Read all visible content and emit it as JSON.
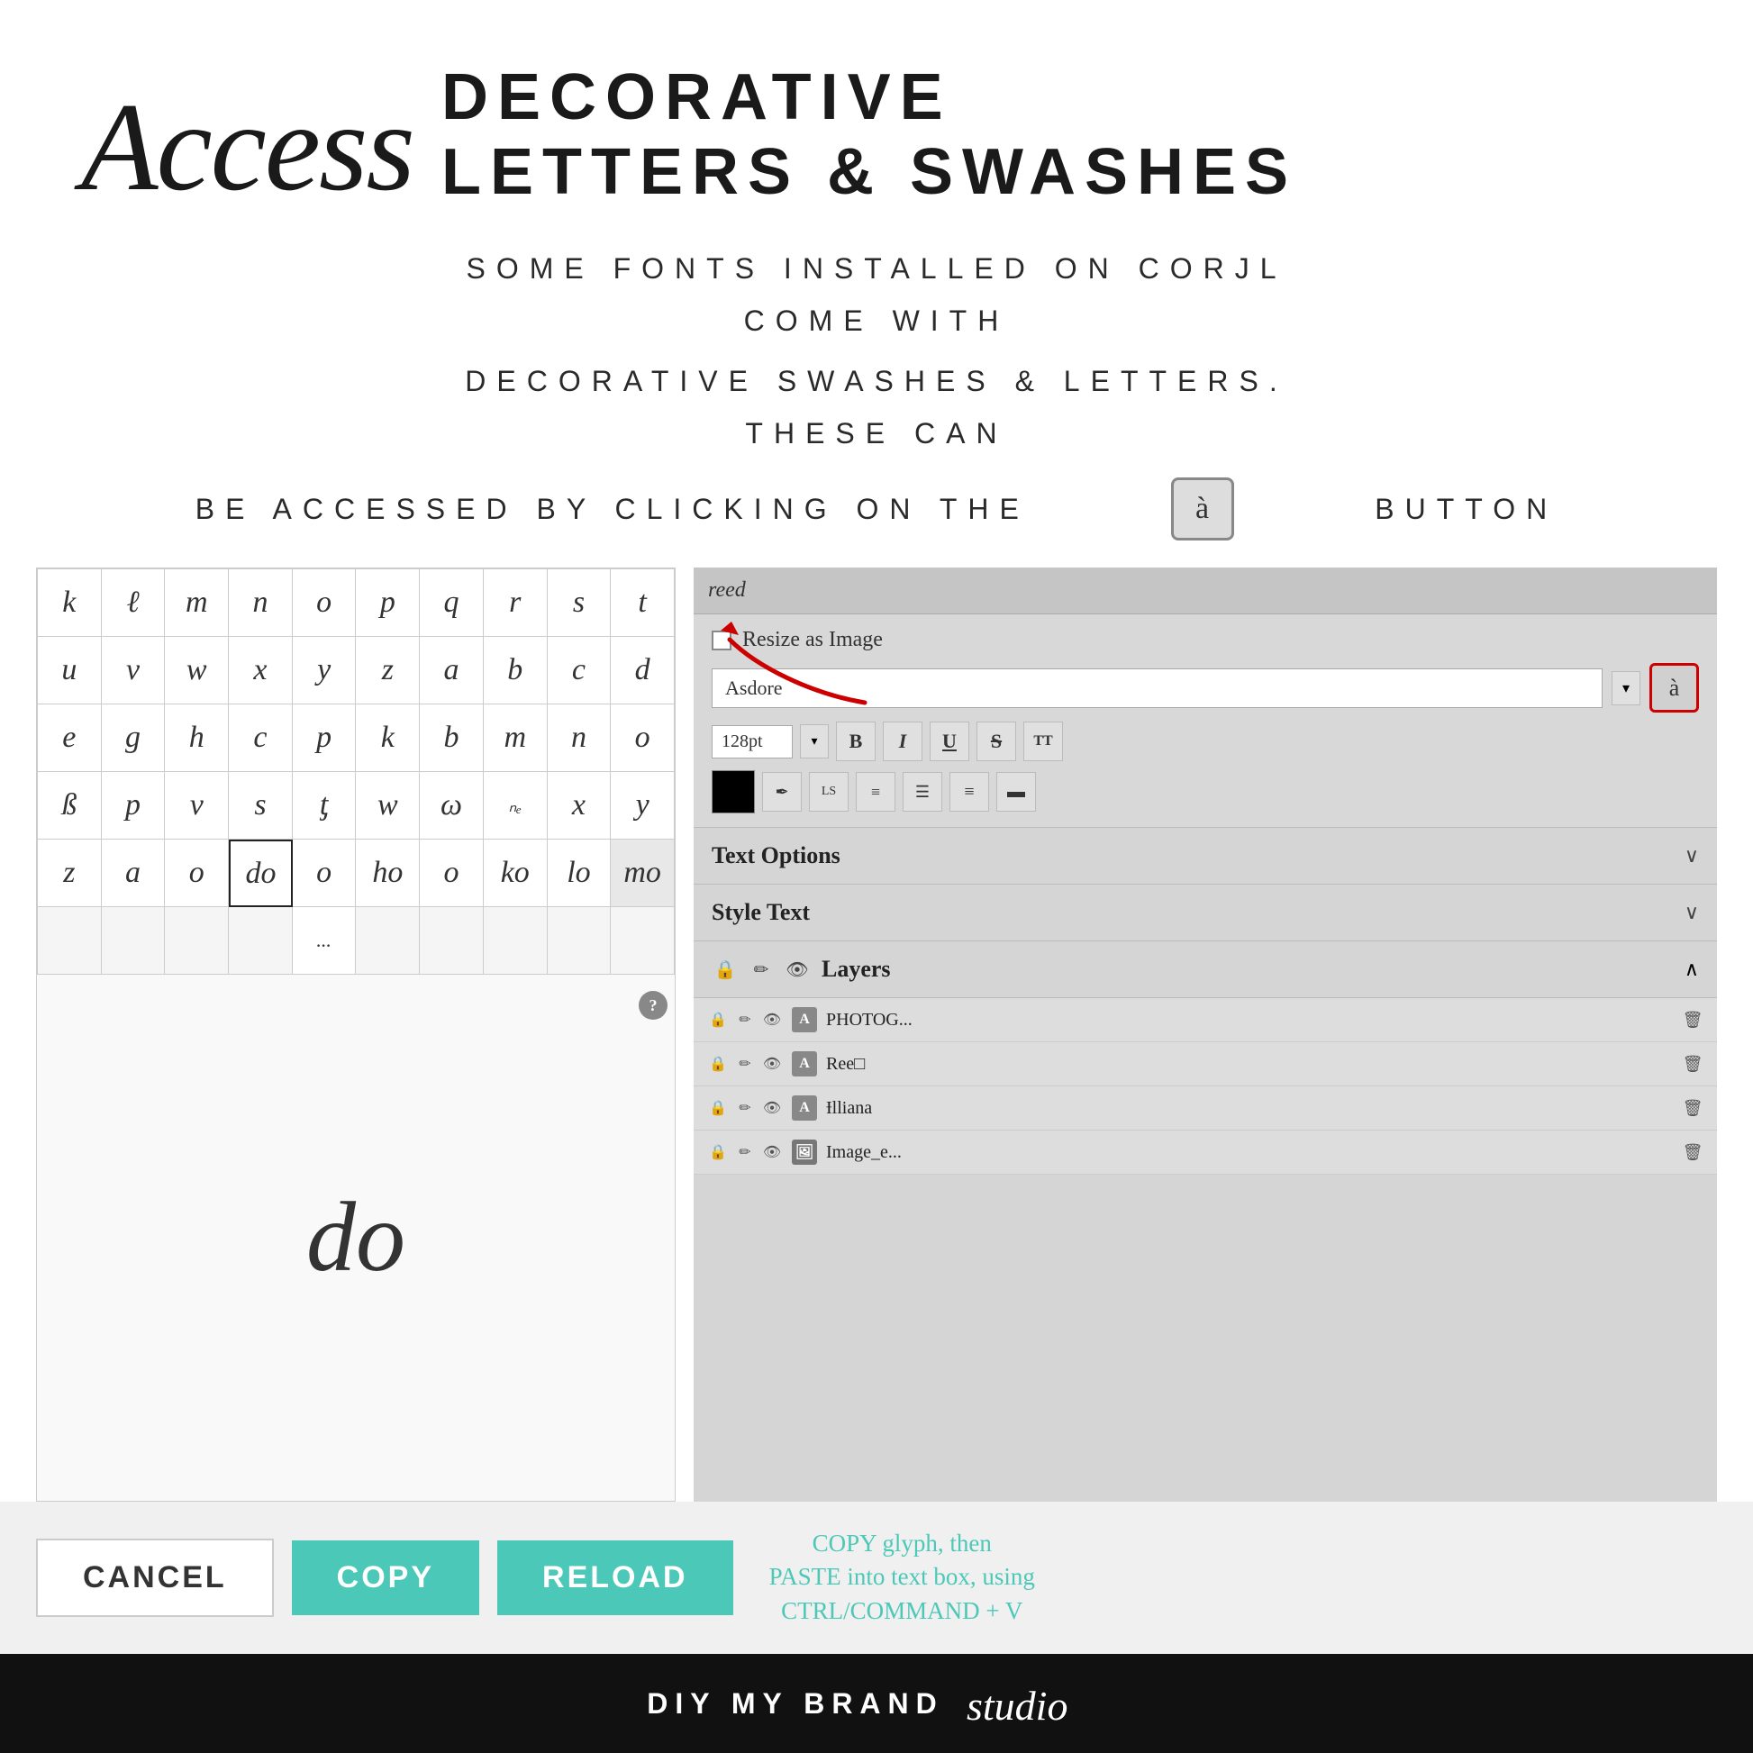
{
  "header": {
    "script_title": "Access",
    "decorative_line1": "DECORATIVE",
    "decorative_line2": "LETTERS & SWASHES",
    "subtitle_line1": "SOME FONTS INSTALLED ON CORJL COME WITH",
    "subtitle_line2": "DECORATIVE SWASHES & LETTERS. THESE CAN",
    "subtitle_line3": "BE ACCESSED BY CLICKING ON THE",
    "subtitle_button_char": "à",
    "subtitle_suffix": "BUTTON"
  },
  "glyph_grid": {
    "rows": [
      [
        "k",
        "ℓ",
        "m",
        "n",
        "o",
        "p",
        "q",
        "r",
        "s",
        "t"
      ],
      [
        "u",
        "v",
        "w",
        "x",
        "y",
        "z",
        "a",
        "b",
        "c",
        "d"
      ],
      [
        "e",
        "g",
        "h",
        "c",
        "p",
        "k",
        "b",
        "m",
        "n",
        "o"
      ],
      [
        "ß",
        "p",
        "v",
        "s",
        "ƫ",
        "w",
        "ω",
        "ₙₑ",
        "x",
        "y"
      ],
      [
        "z",
        "a",
        "o",
        "do",
        "o",
        "ho",
        "o",
        "ko",
        "lo",
        "mo"
      ]
    ],
    "selected_cell": [
      4,
      3
    ],
    "preview_char": "do"
  },
  "actions": {
    "cancel_label": "CANCEL",
    "copy_label": "COPY",
    "reload_label": "RELOAD",
    "instructions": "COPY glyph, then\nPASTE into text box, using\nCTRL/COMMAND + V"
  },
  "sidebar": {
    "search_placeholder": "reed",
    "resize_label": "Resize as Image",
    "font_name": "Asdore",
    "font_size": "128pt",
    "text_options_label": "Text Options",
    "style_text_label": "Style Text",
    "layers_label": "Layers",
    "layers": [
      {
        "type": "A",
        "name": "PHOTOG...",
        "active": false
      },
      {
        "type": "A",
        "name": "Ree□",
        "active": false
      },
      {
        "type": "A",
        "name": "Ɨlliana",
        "active": false
      },
      {
        "type": "img",
        "name": "Image_e...",
        "active": false
      }
    ]
  },
  "footer": {
    "brand_text": "DIY MY BRAND",
    "script_text": "studio"
  },
  "icons": {
    "lock": "🔒",
    "pencil": "✏️",
    "eye": "👁",
    "trash": "🗑",
    "chevron_down": "∨",
    "chevron_up": "∧",
    "question": "?"
  }
}
